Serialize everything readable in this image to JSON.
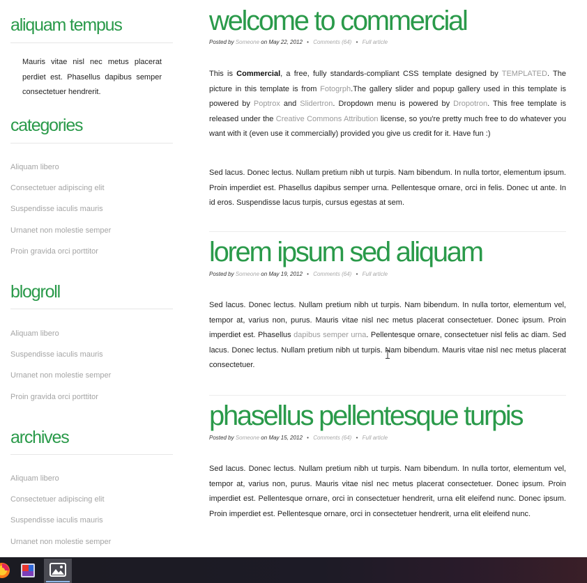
{
  "sidebar": {
    "about": {
      "title": "aliquam tempus",
      "text": "Mauris vitae nisl nec metus placerat perdiet est. Phasellus dapibus semper consectetuer hendrerit."
    },
    "categories": {
      "title": "categories",
      "items": [
        "Aliquam libero",
        "Consectetuer adipiscing elit",
        "Suspendisse iaculis mauris",
        "Urnanet non molestie semper",
        "Proin gravida orci porttitor"
      ]
    },
    "blogroll": {
      "title": "blogroll",
      "items": [
        "Aliquam libero",
        "Suspendisse iaculis mauris",
        "Urnanet non molestie semper",
        "Proin gravida orci porttitor"
      ]
    },
    "archives": {
      "title": "archives",
      "items": [
        "Aliquam libero",
        "Consectetuer adipiscing elit",
        "Suspendisse iaculis mauris",
        "Urnanet non molestie semper"
      ]
    }
  },
  "meta_labels": {
    "posted_by": "Posted by",
    "on": "on",
    "sep": "•"
  },
  "posts": [
    {
      "title": "welcome to commercial",
      "author": "Someone",
      "date": "May 22, 2012",
      "comments": "Comments (64)",
      "full": "Full article",
      "intro": {
        "t1": "This is ",
        "brand": "Commercial",
        "t2": ", a free, fully standards-compliant CSS template designed by ",
        "link_templated": "TEMPLATED",
        "t3": ". The picture in this template is from ",
        "link_fotogrph": "Fotogrph",
        "t4": ".The gallery slider and popup gallery used in this template is powered by ",
        "link_poptrox": "Poptrox",
        "t5": " and ",
        "link_slidertron": "Slidertron",
        "t6": ". Dropdown menu is powered by ",
        "link_dropotron": "Dropotron",
        "t7": ". This free template is released under the ",
        "link_cc": "Creative Commons Attribution",
        "t8": " license, so you're pretty much free to do whatever you want with it (even use it commercially) provided you give us credit for it. Have fun :)"
      },
      "body": "Sed lacus. Donec lectus. Nullam pretium nibh ut turpis. Nam bibendum. In nulla tortor, elementum ipsum. Proin imperdiet est. Phasellus dapibus semper urna. Pellentesque ornare, orci in felis. Donec ut ante. In id eros. Suspendisse lacus turpis, cursus egestas at sem."
    },
    {
      "title": "lorem ipsum sed aliquam",
      "author": "Someone",
      "date": "May 19, 2012",
      "comments": "Comments (64)",
      "full": "Full article",
      "body1": "Sed lacus. Donec lectus. Nullam pretium nibh ut turpis. Nam bibendum. In nulla tortor, elementum vel, tempor at, varius non, purus. Mauris vitae nisl nec metus placerat consectetuer. Donec ipsum. Proin imperdiet est. Phasellus ",
      "link": "dapibus semper urna",
      "body2": ". Pellentesque ornare, consectetuer nisl felis ac diam. Sed lacus. Donec lectus. Nullam pretium nibh ut turpis. Nam bibendum. Mauris vitae nisl nec metus placerat consectetuer."
    },
    {
      "title": "phasellus pellentesque turpis",
      "author": "Someone",
      "date": "May 15, 2012",
      "comments": "Comments (64)",
      "full": "Full article",
      "body": "Sed lacus. Donec lectus. Nullam pretium nibh ut turpis. Nam bibendum. In nulla tortor, elementum vel, tempor at, varius non, purus. Mauris vitae nisl nec metus placerat consectetuer. Donec ipsum. Proin imperdiet est. Pellentesque ornare, orci in consectetuer hendrerit, urna elit eleifend nunc. Donec ipsum. Proin imperdiet est. Pellentesque ornare, orci in consectetuer hendrerit, urna elit eleifend nunc."
    }
  ],
  "taskbar": {
    "items": [
      "firefox-icon",
      "app-icon",
      "image-viewer-icon"
    ],
    "colors": {
      "accent": "#8fb8e8",
      "active_bg": "#4a4a52"
    }
  },
  "colors": {
    "heading_green": "#2a9a4a",
    "link_gray": "#a4a4a4",
    "text": "#222222"
  }
}
